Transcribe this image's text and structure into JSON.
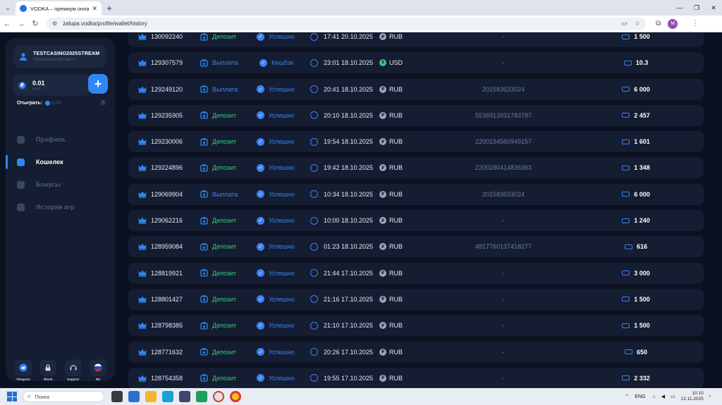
{
  "browser": {
    "tab_title": "VODKA – премиум онлайн-ка",
    "url": "zalupa.vodka/profile/wallet/history",
    "profile_initial": "M"
  },
  "sidebar": {
    "username": "TESTCASINO2025STREAM",
    "email": "streamcasino@mail.ru",
    "balance": "0.01",
    "balance_currency": "RUB",
    "wager_label": "Отыграть:",
    "wager_value": "0.00",
    "nav": [
      {
        "label": "Профиль",
        "icon": "user-icon",
        "active": false
      },
      {
        "label": "Кошелек",
        "icon": "wallet-icon",
        "active": true
      },
      {
        "label": "Бонусы",
        "icon": "gift-icon",
        "active": false
      },
      {
        "label": "История игр",
        "icon": "history-icon",
        "active": false
      }
    ],
    "socials": [
      {
        "label": "Telegram",
        "icon": "telegram-icon"
      },
      {
        "label": "Block",
        "icon": "lock-icon"
      },
      {
        "label": "Support",
        "icon": "support-icon"
      },
      {
        "label": "RU",
        "icon": "flag-ru-icon"
      }
    ]
  },
  "transactions": [
    {
      "id": "130092240",
      "type": "Депозит",
      "status": "Успешно",
      "datetime": "17:41 20.10.2025",
      "currency": "RUB",
      "account": "-",
      "amount": "1 500"
    },
    {
      "id": "129307579",
      "type": "Выплата",
      "status": "Кешбэк",
      "datetime": "23:01 18.10.2025",
      "currency": "USD",
      "account": "-",
      "amount": "10.3"
    },
    {
      "id": "129249120",
      "type": "Выплата",
      "status": "Успешно",
      "datetime": "20:41 18.10.2025",
      "currency": "RUB",
      "account": "201583533024",
      "amount": "6 000"
    },
    {
      "id": "129235905",
      "type": "Депозит",
      "status": "Успешно",
      "datetime": "20:10 18.10.2025",
      "currency": "RUB",
      "account": "5536913931783787",
      "amount": "2 457"
    },
    {
      "id": "129230006",
      "type": "Депозит",
      "status": "Успешно",
      "datetime": "19:54 18.10.2025",
      "currency": "RUB",
      "account": "2200154560949157",
      "amount": "1 601"
    },
    {
      "id": "129224896",
      "type": "Депозит",
      "status": "Успешно",
      "datetime": "19:42 18.10.2025",
      "currency": "RUB",
      "account": "2200280414836363",
      "amount": "1 348"
    },
    {
      "id": "129069904",
      "type": "Выплата",
      "status": "Успешно",
      "datetime": "10:34 18.10.2025",
      "currency": "RUB",
      "account": "201583533024",
      "amount": "6 000"
    },
    {
      "id": "129062216",
      "type": "Депозит",
      "status": "Успешно",
      "datetime": "10:00 18.10.2025",
      "currency": "RUB",
      "account": "-",
      "amount": "1 240"
    },
    {
      "id": "128959084",
      "type": "Депозит",
      "status": "Успешно",
      "datetime": "01:23 18.10.2025",
      "currency": "RUB",
      "account": "4817760137418277",
      "amount": "616"
    },
    {
      "id": "128819921",
      "type": "Депозит",
      "status": "Успешно",
      "datetime": "21:44 17.10.2025",
      "currency": "RUB",
      "account": "-",
      "amount": "3 000"
    },
    {
      "id": "128801427",
      "type": "Депозит",
      "status": "Успешно",
      "datetime": "21:16 17.10.2025",
      "currency": "RUB",
      "account": "-",
      "amount": "1 500"
    },
    {
      "id": "128798385",
      "type": "Депозит",
      "status": "Успешно",
      "datetime": "21:10 17.10.2025",
      "currency": "RUB",
      "account": "-",
      "amount": "1 500"
    },
    {
      "id": "128771632",
      "type": "Депозит",
      "status": "Успешно",
      "datetime": "20:26 17.10.2025",
      "currency": "RUB",
      "account": "-",
      "amount": "650"
    },
    {
      "id": "128754358",
      "type": "Депозит",
      "status": "Успешно",
      "datetime": "19:55 17.10.2025",
      "currency": "RUB",
      "account": "-",
      "amount": "2 332"
    }
  ],
  "taskbar": {
    "search_placeholder": "Поиск",
    "lang": "ENG",
    "time": "10:10",
    "date": "12.11.2025"
  },
  "colors": {
    "accent": "#2f86f6",
    "deposit_green": "#3ec780",
    "background": "#0b1120",
    "card": "#141d31"
  }
}
